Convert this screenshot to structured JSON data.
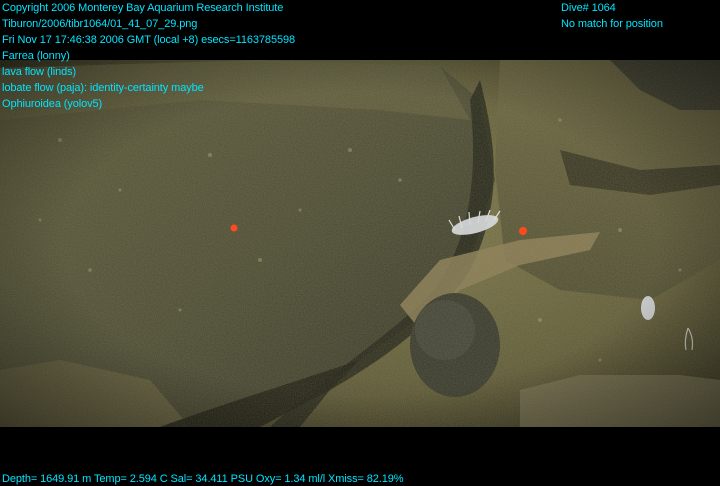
{
  "header": {
    "copyright": "Copyright 2006 Monterey Bay Aquarium Research Institute",
    "file_path": "Tiburon/2006/tibr1064/01_41_07_29.png",
    "timestamp": "Fri Nov 17 17:46:38 2006 GMT (local +8)  esecs=1163785598",
    "annotations": [
      "Farrea (lonny)",
      "lava flow (linds)",
      "lobate flow (paja): identity-certainty maybe",
      "Ophiuroidea (yolov5)"
    ]
  },
  "dive_info": {
    "dive_number": "Dive# 1064",
    "position_status": "No match for position"
  },
  "footer": {
    "telemetry": "Depth= 1649.91 m  Temp= 2.594 C  Sal= 34.411 PSU  Oxy= 1.34 ml/l  Xmiss= 82.19%"
  },
  "colors": {
    "overlay_text": "#00e5ff",
    "background": "#000000",
    "sediment": "#6e6a42",
    "rock": "#3c3d2c",
    "organism_orange": "#ff4a1c"
  }
}
